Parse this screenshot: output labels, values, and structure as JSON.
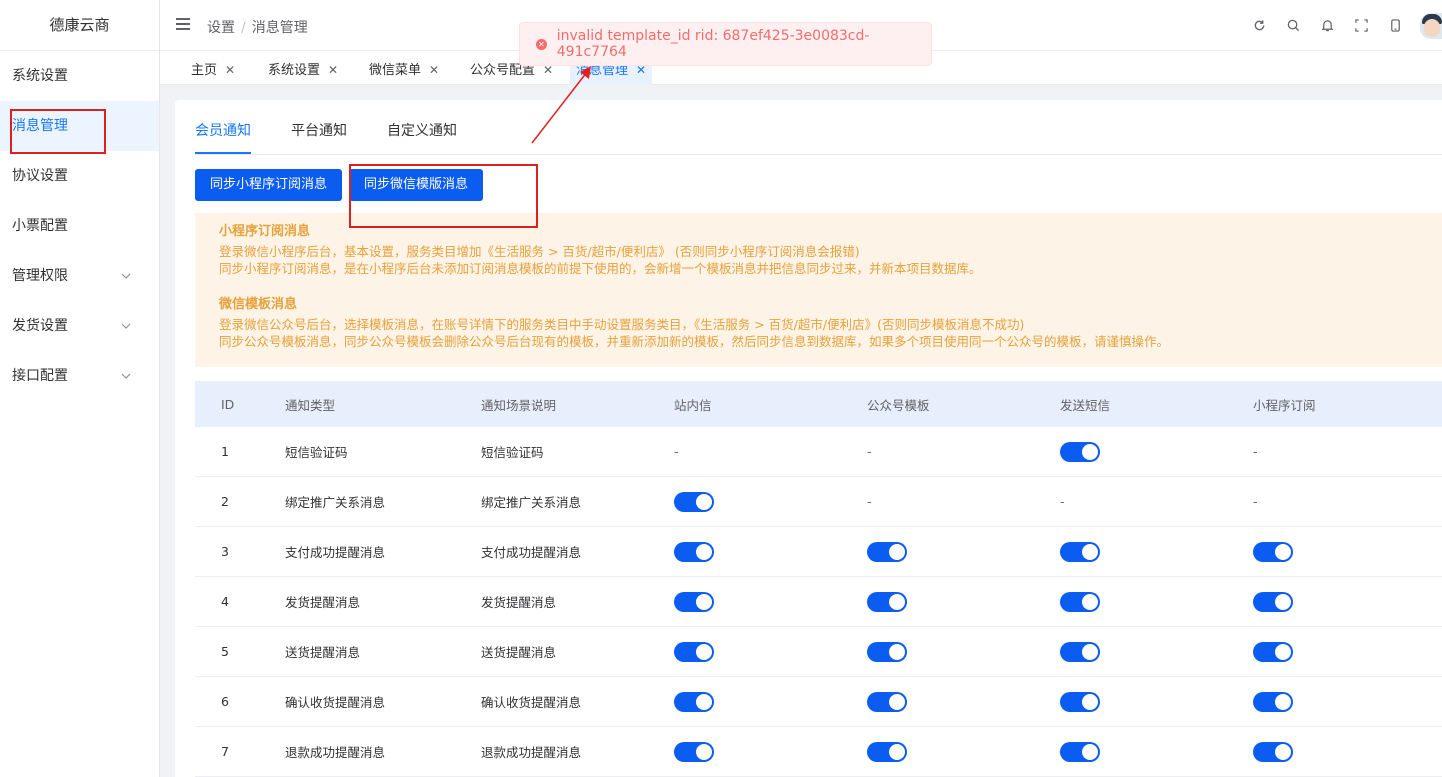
{
  "app": {
    "logo": "德康云商"
  },
  "sidebar": {
    "items": [
      {
        "label": "系统设置",
        "expandable": false
      },
      {
        "label": "消息管理",
        "expandable": false,
        "active": true
      },
      {
        "label": "协议设置",
        "expandable": false
      },
      {
        "label": "小票配置",
        "expandable": false
      },
      {
        "label": "管理权限",
        "expandable": true
      },
      {
        "label": "发货设置",
        "expandable": true
      },
      {
        "label": "接口配置",
        "expandable": true
      }
    ]
  },
  "header": {
    "breadcrumb": [
      "设置",
      "消息管理"
    ],
    "separator": "/",
    "icons": [
      "refresh-icon",
      "search-icon",
      "bell-icon",
      "fullscreen-icon",
      "mobile-icon",
      "avatar"
    ]
  },
  "tags": [
    {
      "label": "主页",
      "close": "✕"
    },
    {
      "label": "系统设置",
      "close": "✕"
    },
    {
      "label": "微信菜单",
      "close": "✕"
    },
    {
      "label": "公众号配置",
      "close": "✕"
    },
    {
      "label": "消息管理",
      "close": "✕",
      "active": true
    }
  ],
  "toast": {
    "message": "invalid template_id rid: 687ef425-3e0083cd-491c7764",
    "icon": "✕"
  },
  "tabs": [
    {
      "label": "会员通知",
      "active": true
    },
    {
      "label": "平台通知"
    },
    {
      "label": "自定义通知"
    }
  ],
  "buttons": {
    "sync_mini": "同步小程序订阅消息",
    "sync_wechat": "同步微信模版消息"
  },
  "notice": {
    "mini_title": "小程序订阅消息",
    "mini_line1": "登录微信小程序后台，基本设置，服务类目增加《生活服务 > 百货/超市/便利店》 (否则同步小程序订阅消息会报错)",
    "mini_line2": "同步小程序订阅消息，是在小程序后台未添加订阅消息模板的前提下使用的，会新增一个模板消息并把信息同步过来，并新本项目数据库。",
    "wx_title": "微信模板消息",
    "wx_line1": "登录微信公众号后台，选择模板消息，在账号详情下的服务类目中手动设置服务类目，《生活服务 > 百货/超市/便利店》(否则同步模板消息不成功)",
    "wx_line2": "同步公众号模板消息，同步公众号模板会删除公众号后台现有的模板，并重新添加新的模板，然后同步信息到数据库，如果多个项目使用同一个公众号的模板，请谨慎操作。"
  },
  "table": {
    "columns": [
      "ID",
      "通知类型",
      "通知场景说明",
      "站内信",
      "公众号模板",
      "发送短信",
      "小程序订阅"
    ],
    "empty_mark": "-",
    "rows": [
      {
        "id": "1",
        "type": "短信验证码",
        "scene": "短信验证码",
        "site": null,
        "wechat": null,
        "sms": true,
        "mini": null
      },
      {
        "id": "2",
        "type": "绑定推广关系消息",
        "scene": "绑定推广关系消息",
        "site": true,
        "wechat": null,
        "sms": null,
        "mini": null
      },
      {
        "id": "3",
        "type": "支付成功提醒消息",
        "scene": "支付成功提醒消息",
        "site": true,
        "wechat": true,
        "sms": true,
        "mini": true
      },
      {
        "id": "4",
        "type": "发货提醒消息",
        "scene": "发货提醒消息",
        "site": true,
        "wechat": true,
        "sms": true,
        "mini": true
      },
      {
        "id": "5",
        "type": "送货提醒消息",
        "scene": "送货提醒消息",
        "site": true,
        "wechat": true,
        "sms": true,
        "mini": true
      },
      {
        "id": "6",
        "type": "确认收货提醒消息",
        "scene": "确认收货提醒消息",
        "site": true,
        "wechat": true,
        "sms": true,
        "mini": true
      },
      {
        "id": "7",
        "type": "退款成功提醒消息",
        "scene": "退款成功提醒消息",
        "site": true,
        "wechat": true,
        "sms": true,
        "mini": true
      }
    ]
  },
  "colors": {
    "primary": "#0b5cf0",
    "error": "#f56c6c",
    "warning": "#e6a23c",
    "annotation": "#e02020"
  }
}
